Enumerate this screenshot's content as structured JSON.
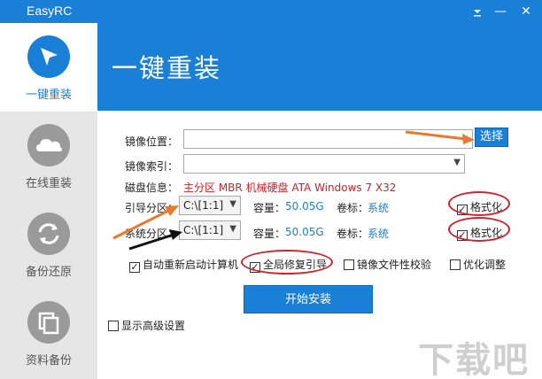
{
  "window": {
    "title": "EasyRC",
    "pin_icon": "pin-icon",
    "minimize_glyph": "—",
    "close_glyph": "✕"
  },
  "header": {
    "title": "一键重装"
  },
  "sidebar": {
    "items": [
      {
        "label": "一键重装",
        "icon": "cursor-arrow-icon"
      },
      {
        "label": "在线重装",
        "icon": "cloud-icon"
      },
      {
        "label": "备份还原",
        "icon": "refresh-icon"
      },
      {
        "label": "资料备份",
        "icon": "copy-icon"
      }
    ]
  },
  "form": {
    "image_location": {
      "label": "镜像位置：",
      "value": ""
    },
    "choose_button": "选择",
    "image_index": {
      "label": "镜像索引：",
      "value": ""
    },
    "disk_info": {
      "label": "磁盘信息：",
      "value": "主分区 MBR 机械硬盘 ATA Windows 7 X32"
    },
    "boot_partition": {
      "label": "引导分区：",
      "value": "C:\\[1:1]",
      "capacity_label": "容量：",
      "capacity": "50.05G",
      "volume_label": "卷标：",
      "volume": "系统",
      "format_label": "格式化",
      "format_checked": true
    },
    "system_partition": {
      "label": "系统分区：",
      "value": "C:\\[1:1]",
      "capacity_label": "容量：",
      "capacity": "50.05G",
      "volume_label": "卷标：",
      "volume": "系统",
      "format_label": "格式化",
      "format_checked": true
    },
    "options": [
      {
        "label": "自动重新启动计算机",
        "checked": true
      },
      {
        "label": "全局修复引导",
        "checked": true
      },
      {
        "label": "镜像文件性校验",
        "checked": false
      },
      {
        "label": "优化调整",
        "checked": false
      }
    ],
    "install_button": "开始安装",
    "advanced": {
      "label": "显示高级设置",
      "checked": false
    }
  },
  "watermark": "下载吧",
  "colors": {
    "accent": "#1a7fd6",
    "annotation_red": "#d0232c",
    "arrow_orange": "#e8792e",
    "arrow_black": "#111111"
  }
}
